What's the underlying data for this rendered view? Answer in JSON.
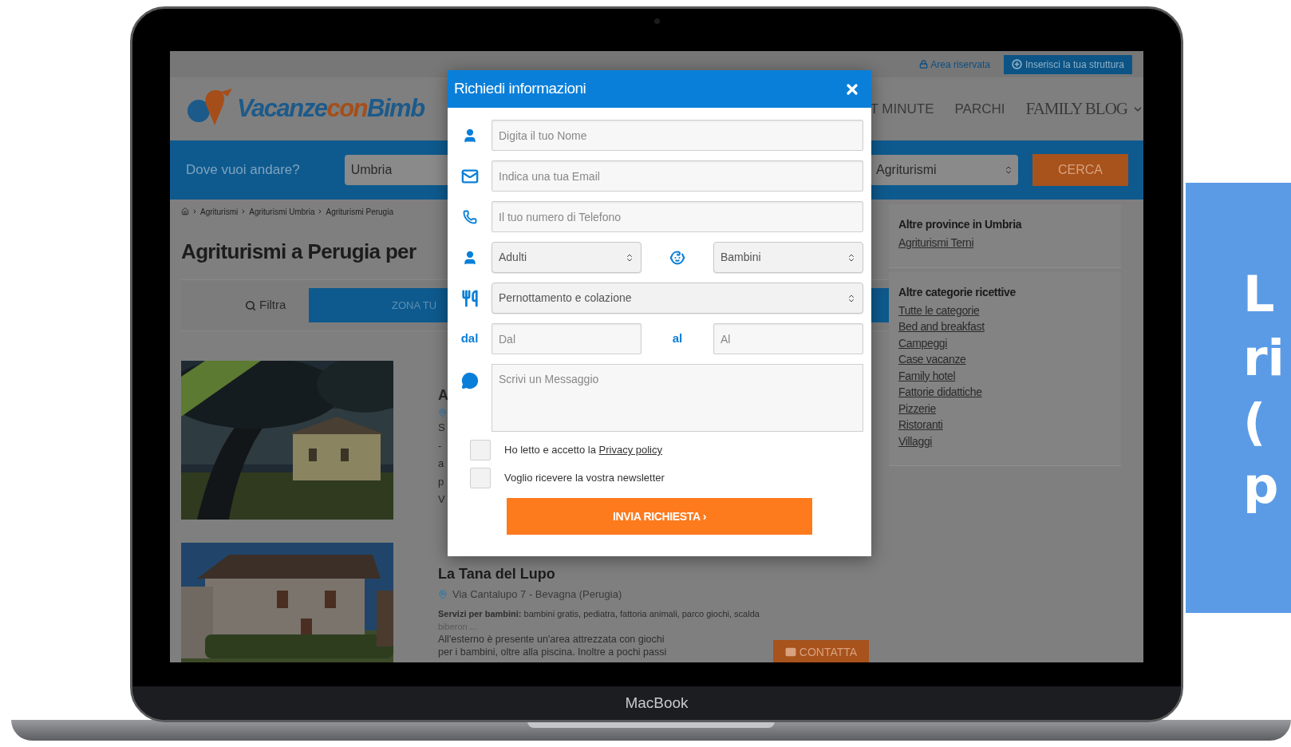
{
  "device": {
    "label": "MacBook"
  },
  "side_banner": {
    "lines": [
      "L",
      "ri",
      "(",
      "p"
    ]
  },
  "site": {
    "top_bar": {
      "reserved_area": "Area riservata",
      "add_button": "Inserisci la tua struttura"
    },
    "logo": {
      "part1": "Vacanze",
      "part2": "con",
      "part3": "Bimb"
    },
    "nav": [
      {
        "label": "T MINUTE",
        "kind": "link"
      },
      {
        "label": "PARCHI",
        "kind": "link"
      },
      {
        "label": "FAMILY BLOG",
        "kind": "dropdown"
      }
    ],
    "search": {
      "prompt": "Dove vuoi andare?",
      "region": "Umbria",
      "category": "Agriturismi",
      "button": "CERCA"
    },
    "breadcrumb": [
      "Agriturismi",
      "Agriturismi Umbria",
      "Agriturismi Perugia"
    ],
    "title": "Agriturismi a Perugia per",
    "filter": {
      "label": "Filtra",
      "tab": "ZONA TU"
    },
    "listings": [
      {
        "kind": "covered",
        "title": "A",
        "lines": [
          "S",
          "-",
          "a",
          "p",
          "V"
        ]
      },
      {
        "kind": "full",
        "title": "La Tana del Lupo",
        "address": "Via Cantalupo 7 - Bevagna (Perugia)",
        "services": "**Servizi per bambini:** bambini gratis, pediatra, fattoria animali, parco giochi, scalda",
        "lines": [
          "biberon ...",
          "All'esterno è presente un'area attrezzata con giochi",
          "per i bambini, oltre alla piscina. Inoltre a pochi passi"
        ],
        "button": "CONTATTA"
      }
    ],
    "sidebar": [
      {
        "title": "Altre province in Umbria",
        "links": [
          "Agriturismi Terni"
        ]
      },
      {
        "title": "Altre categorie ricettive",
        "links": [
          "Tutte le categorie",
          "Bed and breakfast",
          "Campeggi",
          "Case vacanze",
          "Family hotel",
          "Fattorie didattiche",
          "Pizzerie",
          "Ristoranti",
          "Villaggi"
        ]
      }
    ]
  },
  "modal": {
    "title": "Richiedi informazioni",
    "name": {
      "placeholder": "Digita il tuo Nome"
    },
    "email": {
      "placeholder": "Indica una tua Email"
    },
    "phone": {
      "placeholder": "Il tuo numero di Telefono"
    },
    "adults": {
      "value": "Adulti"
    },
    "children": {
      "value": "Bambini"
    },
    "meal": {
      "value": "Pernottamento e colazione"
    },
    "from": {
      "label": "dal",
      "placeholder": "Dal"
    },
    "to": {
      "label": "al",
      "placeholder": "Al"
    },
    "message": {
      "placeholder": "Scrivi un Messaggio"
    },
    "consents": [
      {
        "text": "Ho letto e accetto la",
        "link": "Privacy policy",
        "checked": false
      },
      {
        "text": "Voglio ricevere la vostra newsletter",
        "checked": false
      }
    ],
    "submit": "INVIA RICHIESTA ›"
  }
}
